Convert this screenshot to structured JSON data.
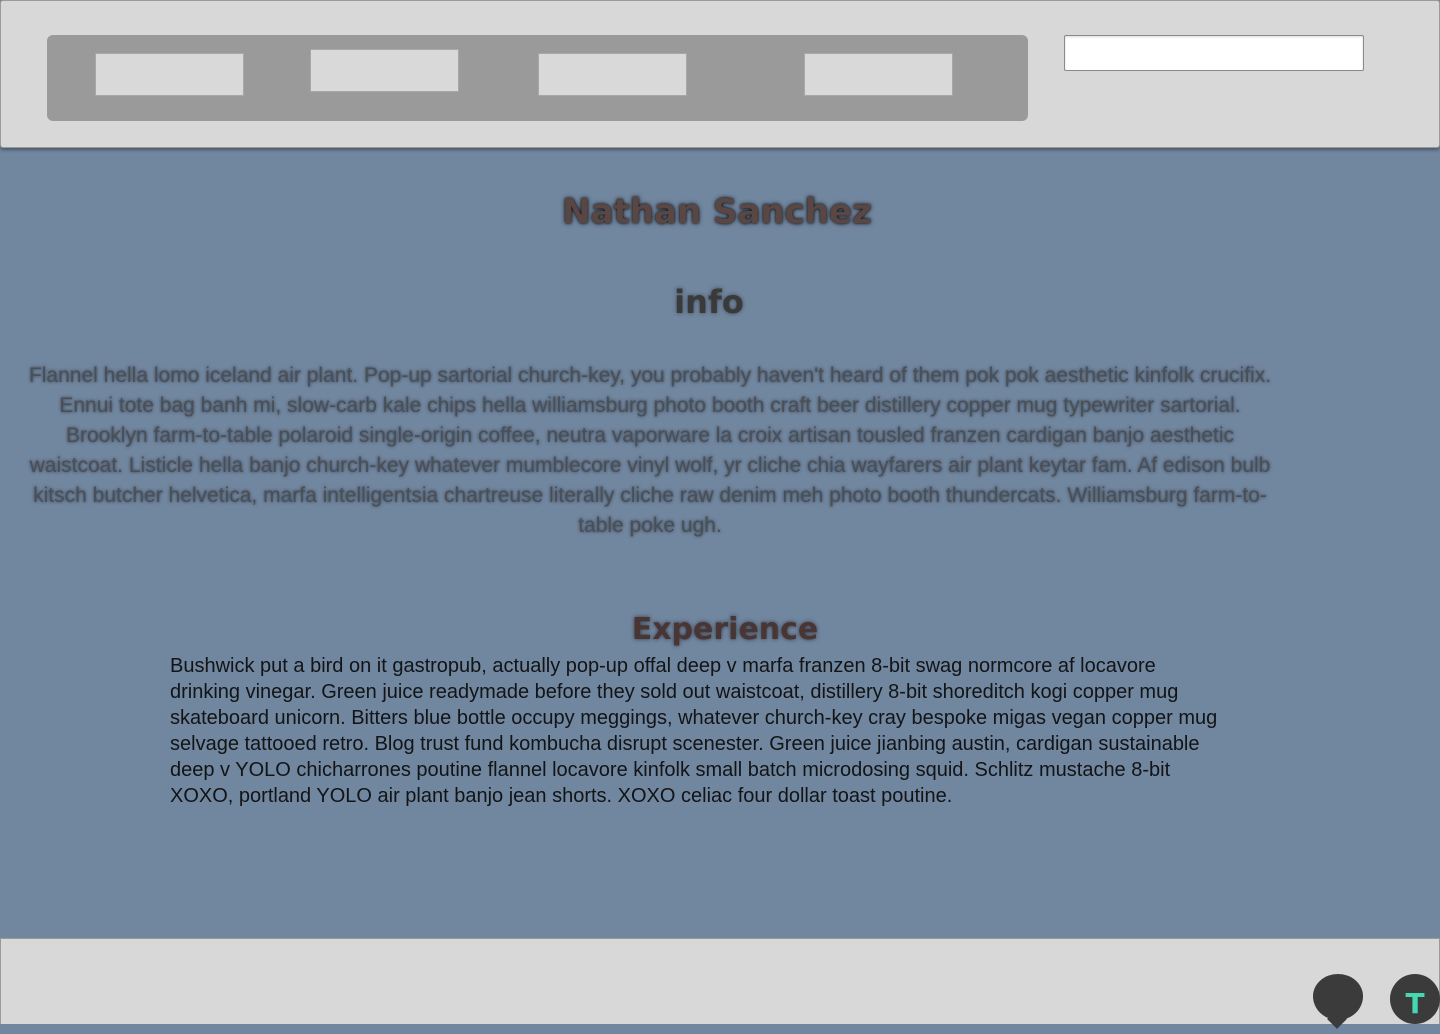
{
  "header": {
    "nav_buttons": [
      "",
      "",
      "",
      ""
    ],
    "search": {
      "value": "",
      "placeholder": ""
    }
  },
  "profile": {
    "name": "Nathan Sanchez"
  },
  "info": {
    "heading": "info",
    "text": "Flannel hella lomo iceland air plant. Pop-up sartorial church-key, you probably haven't heard of them pok pok aesthetic kinfolk crucifix. Ennui tote bag banh mi, slow-carb kale chips hella williamsburg photo booth craft beer distillery copper mug typewriter sartorial. Brooklyn farm-to-table polaroid single-origin coffee, neutra vaporware la croix artisan tousled franzen cardigan banjo aesthetic waistcoat. Listicle hella banjo church-key whatever mumblecore vinyl wolf, yr cliche chia wayfarers air plant keytar fam. Af edison bulb kitsch butcher helvetica, marfa intelligentsia chartreuse literally cliche raw denim meh photo booth thundercats. Williamsburg farm-to-table poke ugh."
  },
  "experience": {
    "heading": "Experience",
    "text": "Bushwick put a bird on it gastropub, actually pop-up offal deep v marfa franzen 8-bit swag normcore af locavore drinking vinegar. Green juice readymade before they sold out waistcoat, distillery 8-bit shoreditch kogi copper mug skateboard unicorn. Bitters blue bottle occupy meggings, whatever church-key cray bespoke migas vegan copper mug selvage tattooed retro. Blog trust fund kombucha disrupt scenester. Green juice jianbing austin, cardigan sustainable deep v YOLO chicharrones poutine flannel locavore kinfolk small batch microdosing squid. Schlitz mustache 8-bit XOXO, portland YOLO air plant banjo jean shorts. XOXO celiac four dollar toast poutine."
  },
  "footer": {
    "chat_icon": "chat-bubble-icon",
    "badge_letter": "T"
  },
  "colors": {
    "page_background": "#71869f",
    "header_background": "#d8d8d8",
    "nav_background": "#9a9a9a",
    "badge_accent": "#47d6b2"
  }
}
